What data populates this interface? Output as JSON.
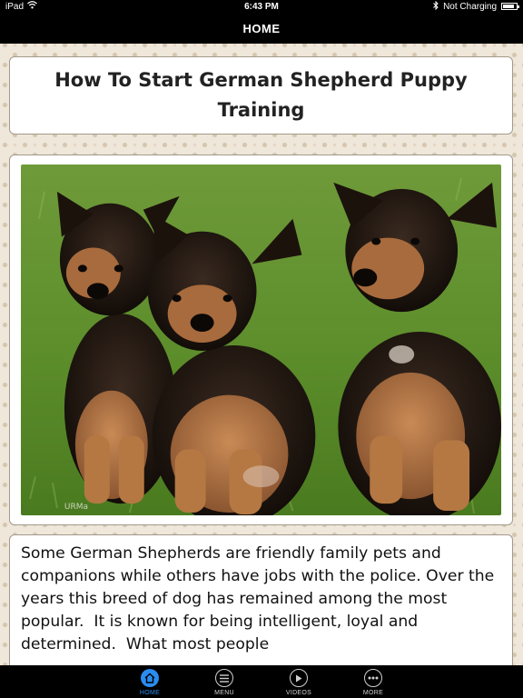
{
  "status_bar": {
    "device": "iPad",
    "time": "6:43 PM",
    "battery_status": "Not Charging",
    "battery_level": 0.85,
    "icons": [
      "wifi-icon",
      "bluetooth-icon",
      "battery-icon"
    ]
  },
  "nav": {
    "title": "HOME"
  },
  "article": {
    "title": "How To Start German Shepherd Puppy Training",
    "image_watermark": "URMa",
    "body": "Some German Shepherds are friendly family pets and companions while others have jobs with the police. Over the years this breed of dog has remained among the most popular.  It is known for being intelligent, loyal and determined.  What most people"
  },
  "tab_bar": {
    "active_color": "#2a8cf0",
    "tabs": [
      {
        "label": "HOME",
        "icon": "home-icon",
        "active": true
      },
      {
        "label": "MENU",
        "icon": "menu-icon",
        "active": false
      },
      {
        "label": "VIDEOS",
        "icon": "play-icon",
        "active": false
      },
      {
        "label": "MORE",
        "icon": "more-icon",
        "active": false
      }
    ]
  }
}
